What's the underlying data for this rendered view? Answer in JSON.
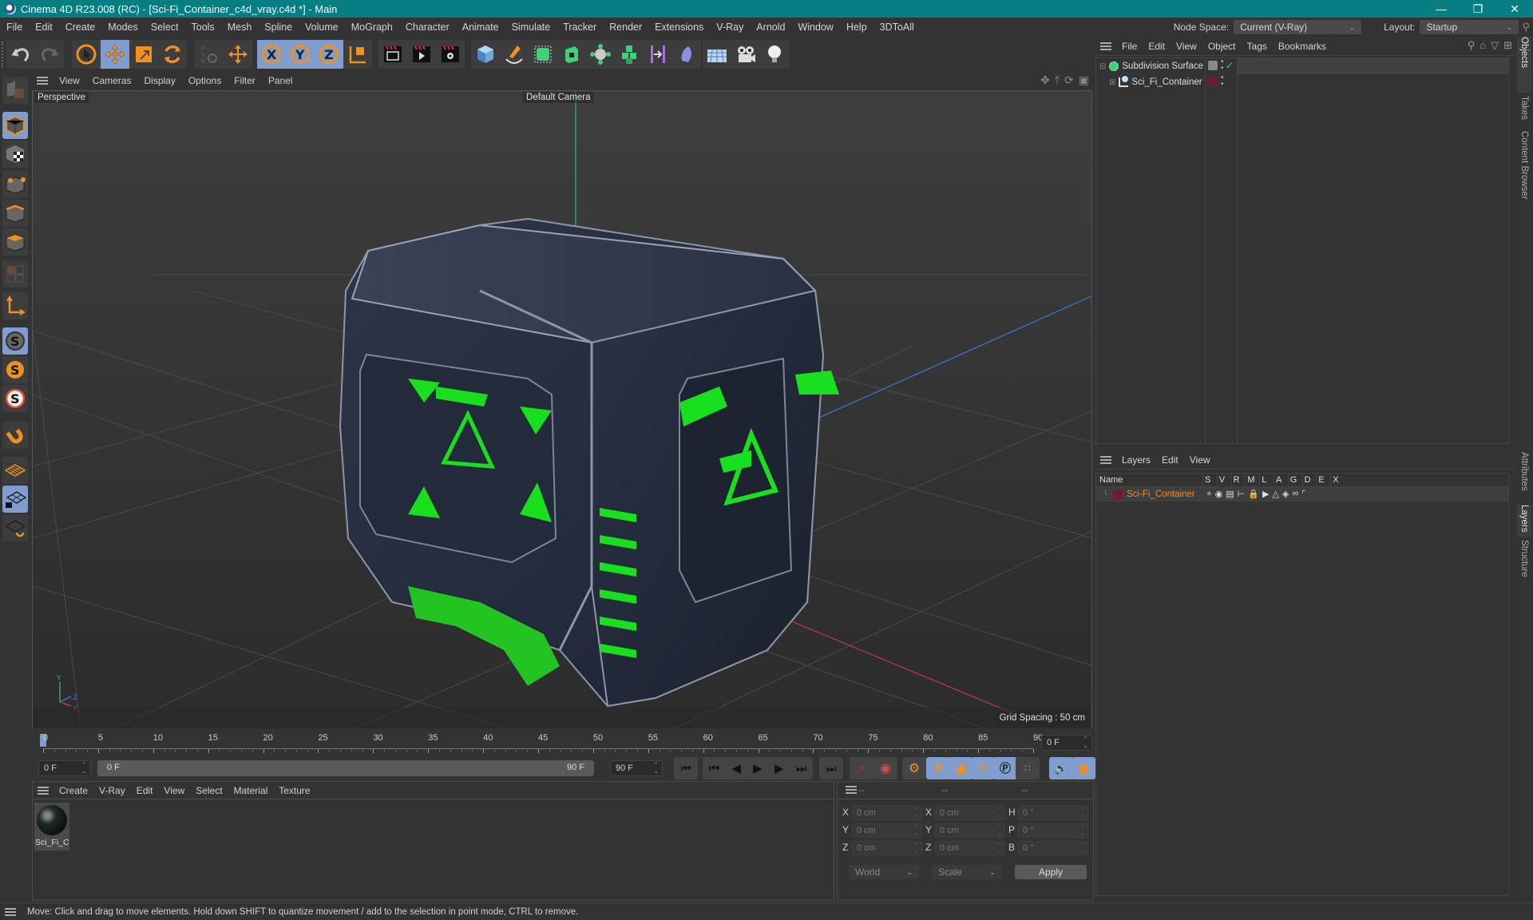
{
  "window": {
    "title": "Cinema 4D R23.008 (RC) - [Sci-Fi_Container_c4d_vray.c4d *] - Main",
    "controls": [
      "minimize",
      "restore",
      "close"
    ]
  },
  "menubar": {
    "items": [
      "File",
      "Edit",
      "Create",
      "Modes",
      "Select",
      "Tools",
      "Mesh",
      "Spline",
      "Volume",
      "MoGraph",
      "Character",
      "Animate",
      "Simulate",
      "Tracker",
      "Render",
      "Extensions",
      "V-Ray",
      "Arnold",
      "Window",
      "Help",
      "3DToAll"
    ],
    "node_space_label": "Node Space:",
    "node_space_value": "Current (V-Ray)",
    "layout_label": "Layout:",
    "layout_value": "Startup"
  },
  "toolbar": {
    "groups": [
      [
        "undo-icon",
        "redo-icon"
      ],
      [
        "live-selection-icon",
        "move-icon",
        "scale-icon",
        "rotate-icon"
      ],
      [
        "psr-icon",
        "move-alt-icon"
      ],
      [
        "x-axis-icon",
        "y-axis-icon",
        "z-axis-icon",
        "coordinate-system-icon"
      ],
      [
        "render-view-icon",
        "render-picture-viewer-icon",
        "render-settings-icon"
      ],
      [
        "cube-icon",
        "pen-icon",
        "subdivision-icon",
        "extrude-icon",
        "cloner-icon",
        "mograph-icon",
        "deformer-icon",
        "field-icon"
      ],
      [
        "floor-icon",
        "camera-icon",
        "light-icon"
      ]
    ]
  },
  "leftbar": {
    "tools": [
      "make-editable-icon",
      "model-mode-icon",
      "texture-mode-icon",
      "points-mode-icon",
      "edges-mode-icon",
      "polygons-mode-icon",
      "uv-mode-icon",
      "axis-mode-icon",
      "solo-off-icon",
      "solo-icon",
      "solo-hierarchy-icon",
      "snap-icon",
      "workplane-icon",
      "locked-workplane-icon",
      "workplane-align-icon"
    ]
  },
  "viewport": {
    "menu": [
      "View",
      "Cameras",
      "Display",
      "Options",
      "Filter",
      "Panel"
    ],
    "view_name": "Perspective",
    "camera_name": "Default Camera",
    "grid_spacing": "Grid Spacing : 50 cm",
    "axis_labels": {
      "x": "X",
      "y": "Y",
      "z": "Z"
    },
    "nav_icons": [
      "pan-icon",
      "dolly-icon",
      "orbit-icon",
      "maximize-view-icon"
    ],
    "colors": {
      "x_axis": "#c0393b",
      "y_axis": "#27b36a",
      "z_axis": "#3a78d6",
      "glow_green": "#19e01e"
    }
  },
  "timeline": {
    "ticks": [
      "0",
      "5",
      "10",
      "15",
      "20",
      "25",
      "30",
      "35",
      "40",
      "45",
      "50",
      "55",
      "60",
      "65",
      "70",
      "75",
      "80",
      "85",
      "90"
    ],
    "current_frame": "0 F",
    "start_field": "0 F",
    "range_start": "0 F",
    "range_end": "90 F",
    "end_field": "90 F",
    "right_frame": "0 F"
  },
  "material_manager": {
    "menu": [
      "Create",
      "V-Ray",
      "Edit",
      "View",
      "Select",
      "Material",
      "Texture"
    ],
    "materials": [
      {
        "name": "Sci_Fi_Cc"
      }
    ]
  },
  "coordinates": {
    "headers": [
      "--",
      "--",
      "--"
    ],
    "rows": [
      {
        "l1": "X",
        "v1": "0 cm",
        "l2": "X",
        "v2": "0 cm",
        "l3": "H",
        "v3": "0 °"
      },
      {
        "l1": "Y",
        "v1": "0 cm",
        "l2": "Y",
        "v2": "0 cm",
        "l3": "P",
        "v3": "0 °"
      },
      {
        "l1": "Z",
        "v1": "0 cm",
        "l2": "Z",
        "v2": "0 cm",
        "l3": "B",
        "v3": "0 °"
      }
    ],
    "mode": "World",
    "size_mode": "Scale",
    "apply_label": "Apply"
  },
  "object_manager": {
    "menu": [
      "File",
      "Edit",
      "View",
      "Object",
      "Tags",
      "Bookmarks"
    ],
    "objects": [
      {
        "name": "Subdivision Surface",
        "expanded": true
      },
      {
        "name": "Sci_Fi_Container",
        "expanded": false
      }
    ]
  },
  "layer_manager": {
    "menu": [
      "Layers",
      "Edit",
      "View"
    ],
    "columns": [
      "Name",
      "S",
      "V",
      "R",
      "M",
      "L",
      "A",
      "G",
      "D",
      "E",
      "X"
    ],
    "layers": [
      {
        "name": "Sci-Fi_Container",
        "color": "#6e1a33"
      }
    ]
  },
  "right_tabs": {
    "top": [
      "Objects",
      "Takes",
      "Content Browser"
    ],
    "bottom": [
      "Attributes",
      "Layers",
      "Structure"
    ]
  },
  "status": {
    "message": "Move: Click and drag to move elements. Hold down SHIFT to quantize movement / add to the selection in point mode, CTRL to remove."
  }
}
